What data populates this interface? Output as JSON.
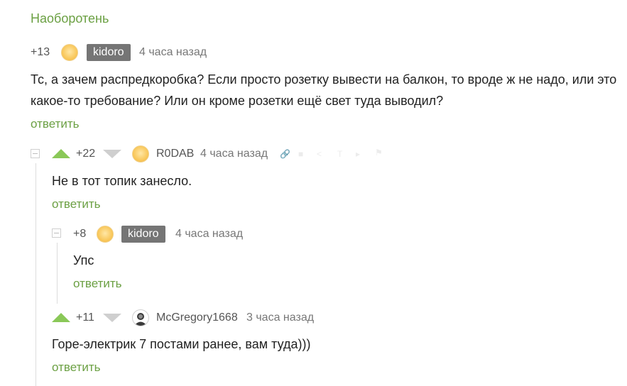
{
  "post_title": "Наоборотень",
  "comments": [
    {
      "rating": "+13",
      "author": "kidoro",
      "time": "4 часа назад",
      "text_line1": "Тс, а зачем распредкоробка? Если просто розетку вывести на балкон, то вроде ж не надо, или это",
      "text_line2": "какое-то требование? Или он кроме розетки ещё свет туда выводил?",
      "reply": "ответить"
    },
    {
      "rating": "+22",
      "author": "R0DAB",
      "time": "4 часа назад",
      "text": "Не в тот топик занесло.",
      "reply": "ответить"
    },
    {
      "rating": "+8",
      "author": "kidoro",
      "time": "4 часа назад",
      "text": "Упс",
      "reply": "ответить"
    },
    {
      "rating": "+11",
      "author": "McGregory1668",
      "time": "3 часа назад",
      "text": "Горе-электрик 7 постами ранее, вам туда)))",
      "reply": "ответить"
    }
  ],
  "colors": {
    "link_green": "#6ba043",
    "upvote_green": "#8ac858",
    "downvote_gray": "#cfcfcf",
    "badge_gray": "#757575"
  }
}
